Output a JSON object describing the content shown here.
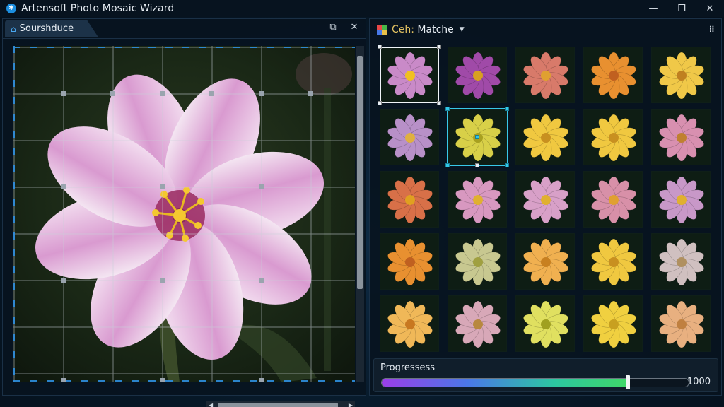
{
  "window": {
    "title": "Artensoft Photo Mosaic Wizard",
    "controls": [
      "—",
      "❐",
      "✕"
    ]
  },
  "source_panel": {
    "tab_label": "Sourshduce",
    "tools": [
      "⧉",
      "✕"
    ]
  },
  "matches_panel": {
    "label_prefix": "Ceh:",
    "label_rest": " Matche",
    "caret": "▼",
    "grid_icon": "⠿"
  },
  "tiles": [
    [
      {
        "color": "#c98ac8",
        "center": "#f0c020"
      },
      {
        "color": "#a04aa8",
        "center": "#d8a020"
      },
      {
        "color": "#d87a6a",
        "center": "#e0a030"
      },
      {
        "color": "#e89030",
        "center": "#c06020"
      },
      {
        "color": "#f0c848",
        "center": "#c08020"
      }
    ],
    [
      {
        "color": "#b890c8",
        "center": "#e0b040"
      },
      {
        "color": "#d8d048",
        "center": "#a8a020"
      },
      {
        "color": "#f0c840",
        "center": "#c89020"
      },
      {
        "color": "#f0c840",
        "center": "#c89020"
      },
      {
        "color": "#d890b0",
        "center": "#c08030"
      }
    ],
    [
      {
        "color": "#d87048",
        "center": "#e0a020"
      },
      {
        "color": "#d898c0",
        "center": "#e0b030"
      },
      {
        "color": "#d8a0c8",
        "center": "#e0b030"
      },
      {
        "color": "#d890a8",
        "center": "#e0a030"
      },
      {
        "color": "#c898c8",
        "center": "#e0b030"
      }
    ],
    [
      {
        "color": "#e89030",
        "center": "#c06020"
      },
      {
        "color": "#c8c890",
        "center": "#a0a040"
      },
      {
        "color": "#f0b050",
        "center": "#c88020"
      },
      {
        "color": "#f0c840",
        "center": "#c89020"
      },
      {
        "color": "#d0c0c0",
        "center": "#b09060"
      }
    ],
    [
      {
        "color": "#f0b858",
        "center": "#c87820"
      },
      {
        "color": "#d8a8b8",
        "center": "#b88840"
      },
      {
        "color": "#e0e060",
        "center": "#a0a020"
      },
      {
        "color": "#f0d040",
        "center": "#c8a020"
      },
      {
        "color": "#e8b080",
        "center": "#c08040"
      }
    ]
  ],
  "progress": {
    "label": "Progressess",
    "value_text": "1000",
    "fraction": 0.8
  },
  "colors": {
    "accent": "#1c8fe0",
    "selection": "#38c8e8"
  }
}
